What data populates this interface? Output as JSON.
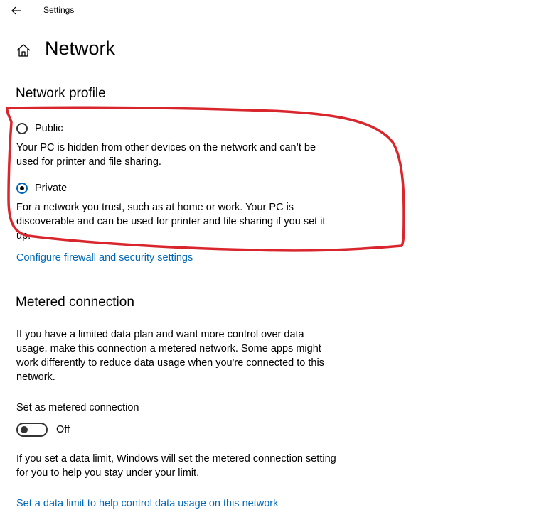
{
  "window": {
    "title": "Settings",
    "back_icon": "back-arrow-icon"
  },
  "header": {
    "home_icon": "home-icon",
    "title": "Network"
  },
  "network_profile": {
    "section_title": "Network profile",
    "options": [
      {
        "label": "Public",
        "selected": false,
        "description": "Your PC is hidden from other devices on the network and can’t be used for printer and file sharing."
      },
      {
        "label": "Private",
        "selected": true,
        "description": "For a network you trust, such as at home or work. Your PC is discoverable and can be used for printer and file sharing if you set it up."
      }
    ],
    "firewall_link": "Configure firewall and security settings"
  },
  "metered": {
    "section_title": "Metered connection",
    "description": "If you have a limited data plan and want more control over data usage, make this connection a metered network. Some apps might work differently to reduce data usage when you're connected to this network.",
    "toggle_label": "Set as metered connection",
    "toggle_state": "Off",
    "toggle_on": false,
    "limit_note": "If you set a data limit, Windows will set the metered connection setting for you to help you stay under your limit.",
    "limit_link": "Set a data limit to help control data usage on this network"
  },
  "colors": {
    "link": "#0067b8",
    "annotation": "#d9262c"
  }
}
